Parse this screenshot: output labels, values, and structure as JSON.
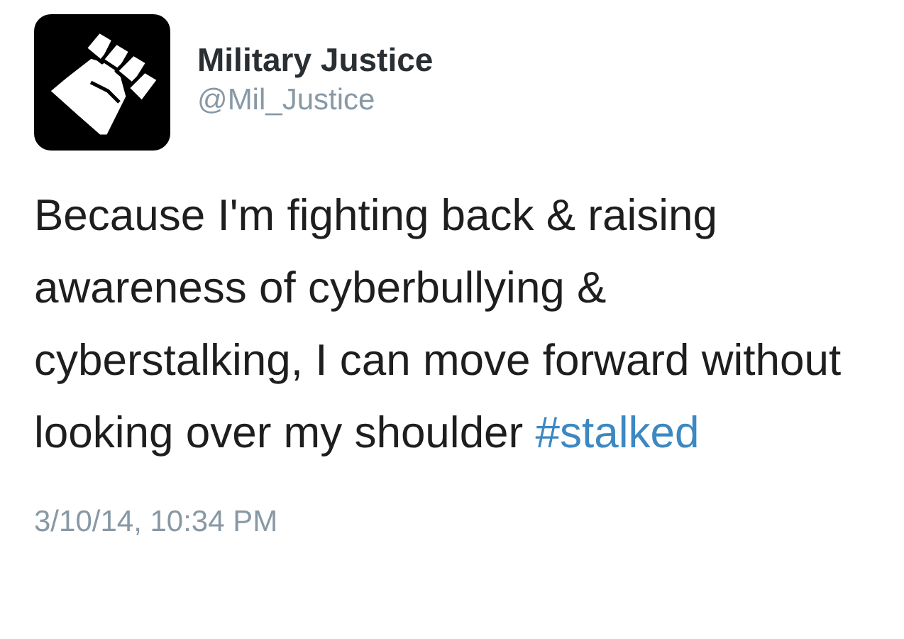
{
  "account": {
    "name": "Military Justice",
    "handle": "@Mil_Justice"
  },
  "tweet": {
    "text": "Because I'm fighting back & raising awareness of cyberbullying & cyberstalking, I can move forward without looking over my shoulder",
    "hashtag": "#stalked"
  },
  "timestamp": "3/10/14, 10:34 PM"
}
